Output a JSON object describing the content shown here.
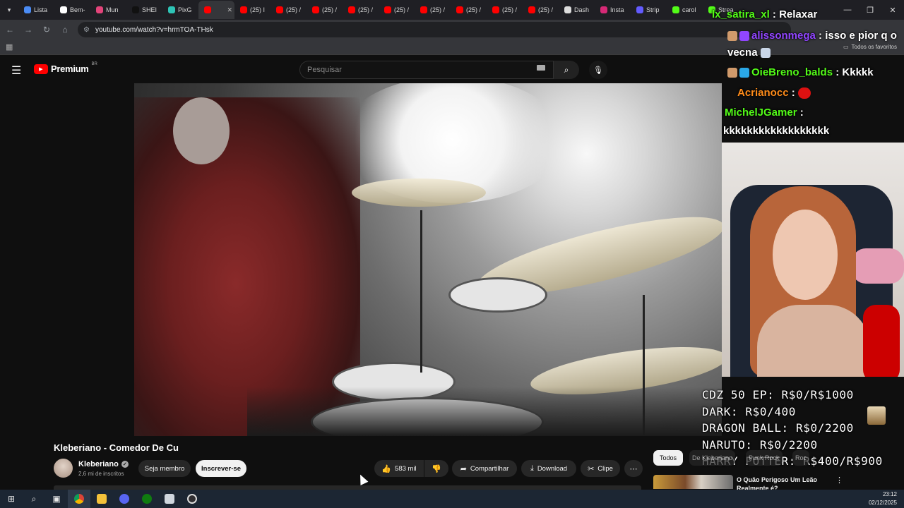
{
  "browser": {
    "tabs": [
      {
        "label": "Lista",
        "color": "#4b8cf5"
      },
      {
        "label": "Bem-",
        "color": "#ffffff"
      },
      {
        "label": "Mun",
        "color": "#e3447a"
      },
      {
        "label": "SHEI",
        "color": "#111111"
      },
      {
        "label": "PixG",
        "color": "#2ec4b6"
      },
      {
        "label": "",
        "color": "#ff0000",
        "active": true
      },
      {
        "label": "(25) I",
        "color": "#ff0000"
      },
      {
        "label": "(25) /",
        "color": "#ff0000"
      },
      {
        "label": "(25) /",
        "color": "#ff0000"
      },
      {
        "label": "(25) /",
        "color": "#ff0000"
      },
      {
        "label": "(25) /",
        "color": "#ff0000"
      },
      {
        "label": "(25) /",
        "color": "#ff0000"
      },
      {
        "label": "(25) /",
        "color": "#ff0000"
      },
      {
        "label": "(25) /",
        "color": "#ff0000"
      },
      {
        "label": "(25) /",
        "color": "#ff0000"
      },
      {
        "label": "Dash",
        "color": "#dddddd"
      },
      {
        "label": "Insta",
        "color": "#d62976"
      },
      {
        "label": "Strip",
        "color": "#635bff"
      },
      {
        "label": "carol",
        "color": "#53fc18"
      },
      {
        "label": "Strea",
        "color": "#53fc18"
      }
    ],
    "address": "youtube.com/watch?v=hrmTOA-THsk",
    "bookmarks_folder": "Todos os favoritos"
  },
  "youtube": {
    "logo_text": "Premium",
    "country": "BR",
    "search_placeholder": "Pesquisar",
    "video_title": "Kleberiano - Comedor De Cu",
    "channel_name": "Kleberiano",
    "subscribers": "2,6 mi de inscritos",
    "join_label": "Seja membro",
    "subscribe_label": "Inscrever-se",
    "likes": "583 mil",
    "share_label": "Compartilhar",
    "download_label": "Download",
    "clip_label": "Clipe",
    "filters": [
      "Todos",
      "De Kleberiano",
      "Punk Rock",
      "Roc"
    ],
    "recommended_title": "O Quão Perigoso Um Leão Realmente é?"
  },
  "stream_overlay": {
    "chat": [
      {
        "user": "lx_satira_xl",
        "message": "Relaxar",
        "color": "#53fc18"
      },
      {
        "user": "alissonmega",
        "message": "isso e pior q o vecna",
        "color": "#9146ff"
      },
      {
        "user": "OieBreno_balds",
        "message": "Kkkkk",
        "color": "#53fc18"
      },
      {
        "user": "Acrianocc",
        "message": "",
        "color": "#ff8c1a"
      },
      {
        "user": "MichelJGamer",
        "message": "kkkkkkkkkkkkkkkkkk",
        "color": "#53fc18"
      }
    ],
    "goals": [
      "CDZ 50 EP: R$0/R$1000",
      "DARK: R$0/400",
      "DRAGON BALL: R$0/2200",
      "NARUTO: R$0/2200",
      "HARRY POTTER: R$400/R$900"
    ]
  },
  "taskbar": {
    "time": "23:12",
    "date": "02/12/2025"
  }
}
